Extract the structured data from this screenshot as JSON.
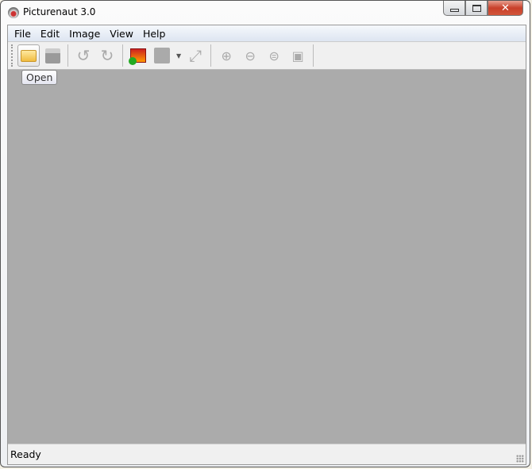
{
  "window": {
    "title": "Picturenaut 3.0"
  },
  "menu": [
    "File",
    "Edit",
    "Image",
    "View",
    "Help"
  ],
  "toolbar": {
    "tooltip": "Open"
  },
  "status": {
    "text": "Ready"
  }
}
